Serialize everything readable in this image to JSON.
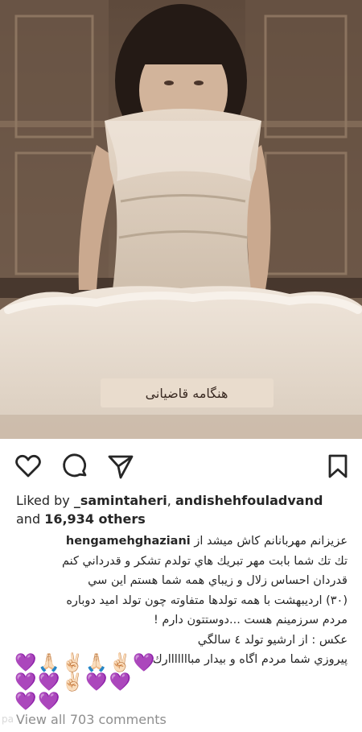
{
  "post": {
    "photo": {
      "cake_inscription": "هنگامه قاضیانی"
    },
    "actions": {
      "like_icon": "heart-outline-icon",
      "comment_icon": "speech-bubble-icon",
      "share_icon": "paper-plane-icon",
      "save_icon": "bookmark-icon"
    },
    "likes": {
      "prefix": "Liked by",
      "user1": "_samintaheri",
      "separator": ",",
      "user2": "andishehfouladvand",
      "middle": "and",
      "others": "16,934 others"
    },
    "caption": {
      "owner": "hengamehghaziani",
      "lines": [
        "عزيزانم مهربانانم كاش ميشد از",
        "تك تك شما بابت مهر تبريك هاي تولدم تشكر  و قدرداني كنم",
        "قدردان احساس زلال و زيباي همه شما هستم  اين سي",
        "(٣٠) ارديبهشت با همه تولدها متفاوته چون تولد اميد دوباره",
        "مردم سرزمينم هست ...دوستتون دارم !",
        "عكس : از ارشيو  تولد ٤ سالگي",
        "پيروزي شما مردم اگاه و بيدار مبااااااارك"
      ],
      "emoji_row1": [
        "💜",
        "🙏🏻",
        "✌🏻",
        "🙏🏻",
        "✌🏻",
        "💜"
      ],
      "emoji_row2": [
        "💜",
        "💜",
        "✌🏻",
        "💜",
        "💜"
      ],
      "emoji_row3": [
        "💜",
        "💜"
      ]
    },
    "view_all": "View all 703 comments",
    "watermark": "pa"
  },
  "colors": {
    "text": "#262626",
    "muted": "#8e8e8e",
    "purple_heart": "#b064d9"
  }
}
